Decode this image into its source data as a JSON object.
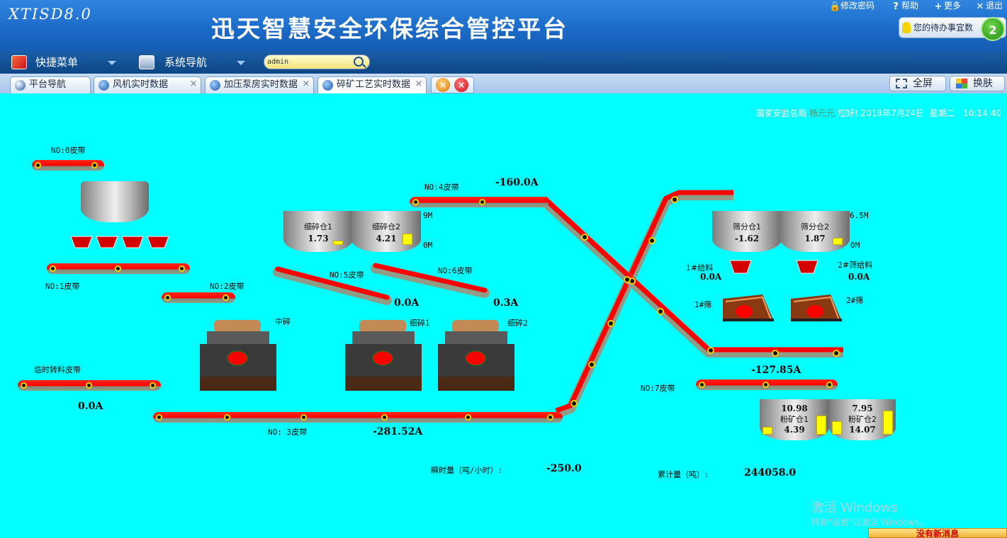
{
  "header": {
    "logo": "XTISD8.0",
    "title": "迅天智慧安全环保综合管控平台",
    "links": {
      "change_password": "修改密码",
      "help": "帮助",
      "more": "更多",
      "logout": "退出"
    },
    "todo_label": "您的待办事宜数",
    "todo_count": "2"
  },
  "nav": {
    "quick_menu": "快捷菜单",
    "system_nav": "系统导航",
    "search_value": "admin",
    "org": "国家安监总局",
    "user_dim": "杨元元",
    "greeting": "您好! 2018年7月24日",
    "weekday": "星期二",
    "time": "10:14:40"
  },
  "tabs": [
    {
      "label": "平台导航",
      "closable": false
    },
    {
      "label": "风机实时数据",
      "closable": true
    },
    {
      "label": "加压泵房实时数据",
      "closable": true
    },
    {
      "label": "碎矿工艺实时数据",
      "closable": true,
      "active": true
    }
  ],
  "buttons": {
    "fullscreen": "全屏",
    "skin": "换肤"
  },
  "process": {
    "belts": {
      "b0": {
        "name": "NO:0皮带"
      },
      "b1": {
        "name": "NO:1皮带"
      },
      "b2": {
        "name": "NO:2皮带"
      },
      "b3": {
        "name": "NO: 3皮带",
        "current": "-281.52A"
      },
      "b4": {
        "name": "NO:4皮带",
        "current": "-160.0A"
      },
      "b5": {
        "name": "NO:5皮带",
        "current": "0.0A"
      },
      "b6": {
        "name": "NO:6皮带",
        "current": "0.3A"
      },
      "b7": {
        "name": "NO:7皮带"
      },
      "temp": {
        "name": "临时转料皮带",
        "current": "0.0A"
      },
      "screen_out": {
        "current": "-127.85A"
      }
    },
    "crushers": {
      "mid": "中碎",
      "fine1": "细碎1",
      "fine2": "细碎2"
    },
    "silos": {
      "fine1": {
        "name": "细碎仓1",
        "value": "1.73",
        "level": 0.19
      },
      "fine2": {
        "name": "细碎仓2",
        "value": "4.21",
        "level": 0.47
      },
      "fine_max": "9M",
      "fine_min": "0M",
      "screen1": {
        "name": "筛分仓1",
        "value": "-1.62",
        "level": 0
      },
      "screen2": {
        "name": "筛分仓2",
        "value": "1.87",
        "level": 0.29
      },
      "screen_max": "6.5M",
      "screen_min": "0M",
      "powder1": {
        "name": "粉矿仓1",
        "value_top": "10.98",
        "value_bottom": "4.39",
        "level_left": 0.31,
        "level_right": 0.78
      },
      "powder2": {
        "name": "粉矿仓2",
        "value_top": "7.95",
        "value_bottom": "14.07",
        "level_left": 0.57,
        "level_right": 1.0
      }
    },
    "feeders": {
      "f1": {
        "name": "1#给料",
        "current": "0.0A"
      },
      "f2": {
        "name": "2#筛给料",
        "current": "0.0A"
      }
    },
    "screens": {
      "s1": "1#筛",
      "s2": "2#筛"
    },
    "totals": {
      "instant_label": "瞬时量（吨/小时）:",
      "instant_value": "-250.0",
      "cumulative_label": "累计量（吨）:",
      "cumulative_value": "244058.0"
    }
  },
  "system": {
    "watermark_line1": "激活 Windows",
    "watermark_line2": "转到\"设置\"以激活 Windows。",
    "message": "没有新消息"
  },
  "colors": {
    "background": "#00ffff",
    "belt_top": "#ff0000",
    "belt_bottom": "#8e9c88",
    "level": "#ffff00"
  }
}
